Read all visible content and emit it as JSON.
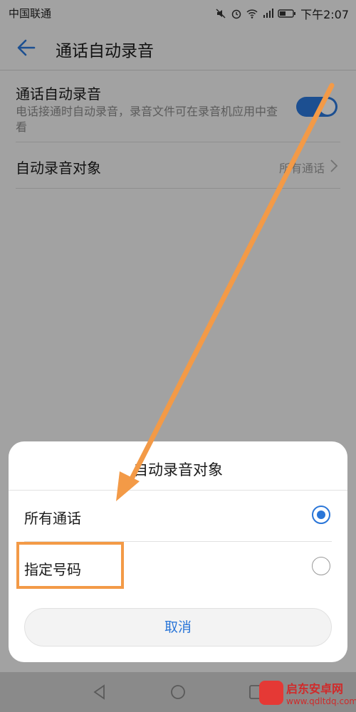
{
  "status_bar": {
    "carrier": "中国联通",
    "time": "下午2:07",
    "icons": [
      "mute-icon",
      "alarm-icon",
      "wifi-icon",
      "signal-icon",
      "battery-icon"
    ]
  },
  "app_bar": {
    "title": "通话自动录音",
    "back_icon": "arrow-left-icon"
  },
  "settings": {
    "auto_record": {
      "title": "通话自动录音",
      "description": "电话接通时自动录音，录音文件可在录音机应用中查看",
      "enabled": true
    },
    "record_target": {
      "title": "自动录音对象",
      "value": "所有通话"
    }
  },
  "dialog": {
    "title": "自动录音对象",
    "options": [
      {
        "label": "所有通话",
        "selected": true
      },
      {
        "label": "指定号码",
        "selected": false
      }
    ],
    "cancel_label": "取消"
  },
  "colors": {
    "accent": "#2a76d8",
    "annotation": "#f39a47",
    "watermark": "#d02a2a"
  },
  "watermark": {
    "name": "启东安卓网",
    "url": "www.qdltdq.com"
  }
}
